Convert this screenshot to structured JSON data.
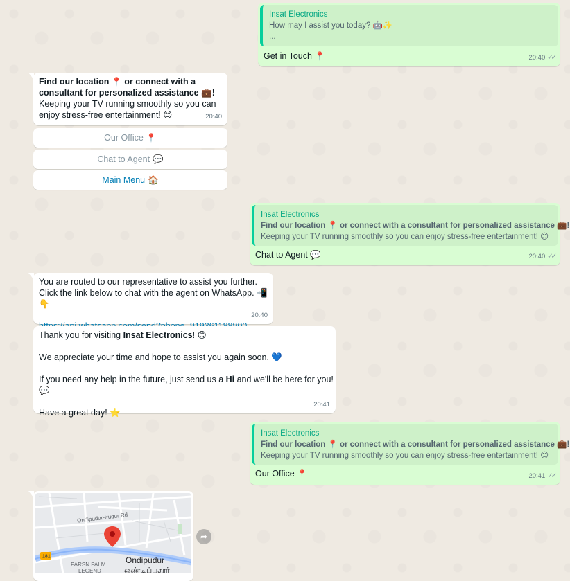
{
  "messages": {
    "m1": {
      "quote_name": "Insat Electronics",
      "quote_line1": "How may I assist you today? 🤖✨",
      "quote_line2": "...",
      "text": "Get in Touch",
      "text_emoji": "📍",
      "time": "20:40"
    },
    "m2": {
      "bold_a": "Find our location ",
      "pin": "📍",
      "bold_b": " or connect with a",
      "bold_c": "consultant for personalized assistance ",
      "briefcase": "💼",
      "bold_d": "!",
      "line3": "Keeping your TV running smoothly so you can",
      "line4": "enjoy stress-free entertainment! ",
      "smile": "😊",
      "time": "20:40"
    },
    "buttons": {
      "office": "Our Office",
      "office_emoji": "📍",
      "agent": "Chat to Agent",
      "agent_emoji": "💬",
      "menu": "Main Menu",
      "menu_emoji": "🏠"
    },
    "m3": {
      "quote_name": "Insat Electronics",
      "quote_bold": "Find our location 📍 or connect with a consultant for personalized assistance 💼!",
      "quote_line": "Keeping your TV running smoothly so you can enjoy stress-free entertainment! 😊",
      "text": "Chat to Agent",
      "text_emoji": "💬",
      "time": "20:40"
    },
    "m4": {
      "line1": "You are routed to our representative to assist you further.",
      "line2": "Click the link below to chat with the agent on WhatsApp. 📲👇",
      "link": "https://api.whatsapp.com/send?phone=919361188900",
      "time": "20:40"
    },
    "m5": {
      "p1a": "Thank you for visiting ",
      "p1b": "Insat Electronics",
      "p1c": "! 😊",
      "p2": "We appreciate your time and hope to assist you again soon. 💙",
      "p3a": "If you need any help in the future, just send us a ",
      "p3b": "Hi",
      "p3c": " and we'll be here for you! 💬",
      "p4": "Have a great day! ⭐",
      "time": "20:41"
    },
    "m6": {
      "quote_name": "Insat Electronics",
      "quote_bold": "Find our location 📍 or connect with a consultant for personalized assistance 💼!",
      "quote_line": "Keeping your TV running smoothly so you can enjoy stress-free entertainment! 😊",
      "text": "Our Office",
      "text_emoji": "📍",
      "time": "20:41"
    }
  },
  "map": {
    "road_label": "Ondipudur-Irugur Rd",
    "route_badge": "181",
    "place_name": "Ondipudur",
    "place_name_tamil": "ஒண்டிப்புதூர்",
    "poi_line1": "PARSN PALM",
    "poi_line2": "LEGEND"
  },
  "icons": {
    "forward": "forward-icon",
    "ticks": "double-check-icon"
  },
  "colors": {
    "outgoing": "#d9fdd3",
    "incoming": "#ffffff",
    "quote_accent": "#06cf9c",
    "link": "#027eb5",
    "background": "#efeae2"
  }
}
